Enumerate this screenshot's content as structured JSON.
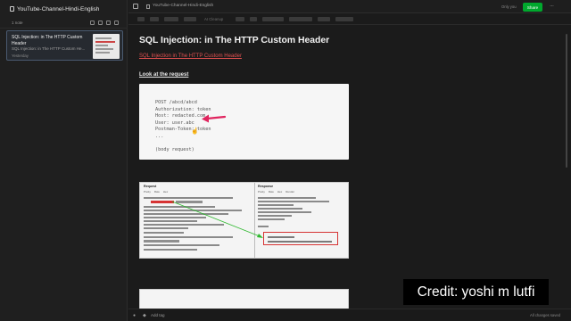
{
  "sidebar": {
    "notebook_title": "YouTube-Channel-Hindi-English",
    "note_count": "1 note",
    "note": {
      "title": "SQL Injection: in The HTTP Custom Header",
      "snippet": "SQL Injection: in The HTTP Custom He...",
      "date": "Yesterday"
    }
  },
  "topbar": {
    "breadcrumb": "YouTube-Channel-Hindi-English",
    "only_you": "Only you",
    "share_label": "Share",
    "more_label": "···"
  },
  "formatbar": {
    "label": "AI Cleanup"
  },
  "note": {
    "title": "SQL Injection:  in The HTTP Custom Header",
    "link_text": "SQL Injection in The HTTP Custom Header",
    "section_heading": "Look at the request",
    "code_lines": [
      "POST /abcd/abcd",
      "Authorization: token",
      "Host: redacted.com",
      "User: user.abc",
      "Postman-Token: token",
      "...",
      "",
      "(body request)"
    ],
    "screenshot": {
      "request_title": "Request",
      "response_title": "Response",
      "request_tabs": [
        "Pretty",
        "Raw",
        "Hex"
      ],
      "response_tabs": [
        "Pretty",
        "Raw",
        "Hex",
        "Render"
      ]
    }
  },
  "credit": "Credit: yoshi m lutfi",
  "bottombar": {
    "add_tag": "Add tag",
    "saved_status": "All changes saved"
  },
  "colors": {
    "accent": "#00a82d",
    "link": "#e05050",
    "arrow": "#e0245e",
    "annotation_arrow": "#2eb82e"
  }
}
